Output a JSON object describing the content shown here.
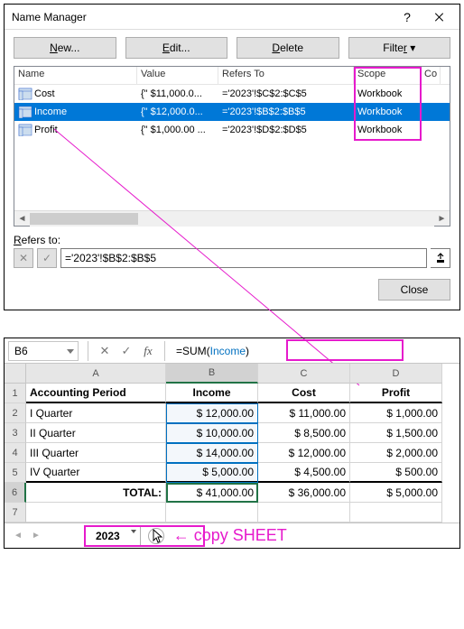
{
  "dialog": {
    "title": "Name Manager",
    "buttons": {
      "new": "New...",
      "edit": "Edit...",
      "delete": "Delete",
      "filter": "Filter"
    },
    "columns": {
      "name": "Name",
      "value": "Value",
      "refers": "Refers To",
      "scope": "Scope",
      "comment": "Co"
    },
    "rows": [
      {
        "name": "Cost",
        "value": "{\" $11,000.0...",
        "refers": "='2023'!$C$2:$C$5",
        "scope": "Workbook"
      },
      {
        "name": "Income",
        "value": "{\" $12,000.0...",
        "refers": "='2023'!$B$2:$B$5",
        "scope": "Workbook"
      },
      {
        "name": "Profit",
        "value": "{\" $1,000.00 ...",
        "refers": "='2023'!$D$2:$D$5",
        "scope": "Workbook"
      }
    ],
    "refers_label": "Refers to:",
    "refers_value": "='2023'!$B$2:$B$5",
    "close": "Close"
  },
  "sheet": {
    "name_box": "B6",
    "formula_prefix": "=SUM(",
    "formula_name": "Income",
    "formula_suffix": ")",
    "headers": {
      "a": "Accounting Period",
      "b": "Income",
      "c": "Cost",
      "d": "Profit"
    },
    "col_letters": [
      "A",
      "B",
      "C",
      "D"
    ],
    "rows": [
      {
        "n": "1"
      },
      {
        "n": "2",
        "a": "I Quarter",
        "b": "$ 12,000.00",
        "c": "$ 11,000.00",
        "d": "$ 1,000.00"
      },
      {
        "n": "3",
        "a": "II Quarter",
        "b": "$ 10,000.00",
        "c": "$   8,500.00",
        "d": "$ 1,500.00"
      },
      {
        "n": "4",
        "a": "III Quarter",
        "b": "$ 14,000.00",
        "c": "$ 12,000.00",
        "d": "$ 2,000.00"
      },
      {
        "n": "5",
        "a": "IV Quarter",
        "b": "$   5,000.00",
        "c": "$   4,500.00",
        "d": "$    500.00"
      },
      {
        "n": "6",
        "a": "TOTAL:",
        "b": "$ 41,000.00",
        "c": "$ 36,000.00",
        "d": "$ 5,000.00"
      },
      {
        "n": "7"
      }
    ],
    "tab": "2023",
    "copy_hint": "← copy SHEET"
  },
  "chart_data": {
    "type": "table",
    "title": "Accounting Period",
    "columns": [
      "Accounting Period",
      "Income",
      "Cost",
      "Profit"
    ],
    "rows": [
      [
        "I Quarter",
        12000,
        11000,
        1000
      ],
      [
        "II Quarter",
        10000,
        8500,
        1500
      ],
      [
        "III Quarter",
        14000,
        12000,
        2000
      ],
      [
        "IV Quarter",
        5000,
        4500,
        500
      ],
      [
        "TOTAL:",
        41000,
        36000,
        5000
      ]
    ]
  }
}
